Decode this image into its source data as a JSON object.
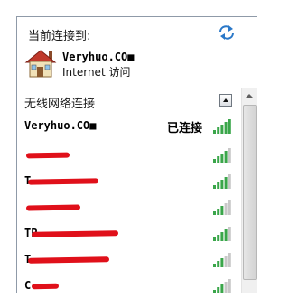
{
  "current": {
    "label": "当前连接到:",
    "network_name": "Veryhuo.CO■",
    "access": "Internet 访问"
  },
  "section": {
    "title": "无线网络连接"
  },
  "networks": [
    {
      "name": "Veryhuo.CO■",
      "status": "已连接",
      "signal_bars": 5,
      "signal_color": "#3aa64a"
    },
    {
      "name": "",
      "status": "",
      "signal_bars": 4,
      "signal_color": "#3aa64a"
    },
    {
      "name": "T",
      "status": "",
      "signal_bars": 4,
      "signal_color": "#3aa64a"
    },
    {
      "name": "",
      "status": "",
      "signal_bars": 3,
      "signal_color": "#3aa64a"
    },
    {
      "name": "TP",
      "status": "",
      "signal_bars": 4,
      "signal_color": "#3aa64a"
    },
    {
      "name": "T",
      "status": "",
      "signal_bars": 3,
      "signal_color": "#3aa64a"
    },
    {
      "name": "C",
      "status": "",
      "signal_bars": 3,
      "signal_color": "#3aa64a"
    }
  ],
  "colors": {
    "signal_on": "#3aa64a",
    "signal_off": "#c8c8c8",
    "redaction": "#e0101a"
  },
  "icons": {
    "refresh": "refresh-icon",
    "network": "house-network-icon",
    "collapse": "collapse-up-arrow",
    "signal": "signal-strength-icon"
  }
}
